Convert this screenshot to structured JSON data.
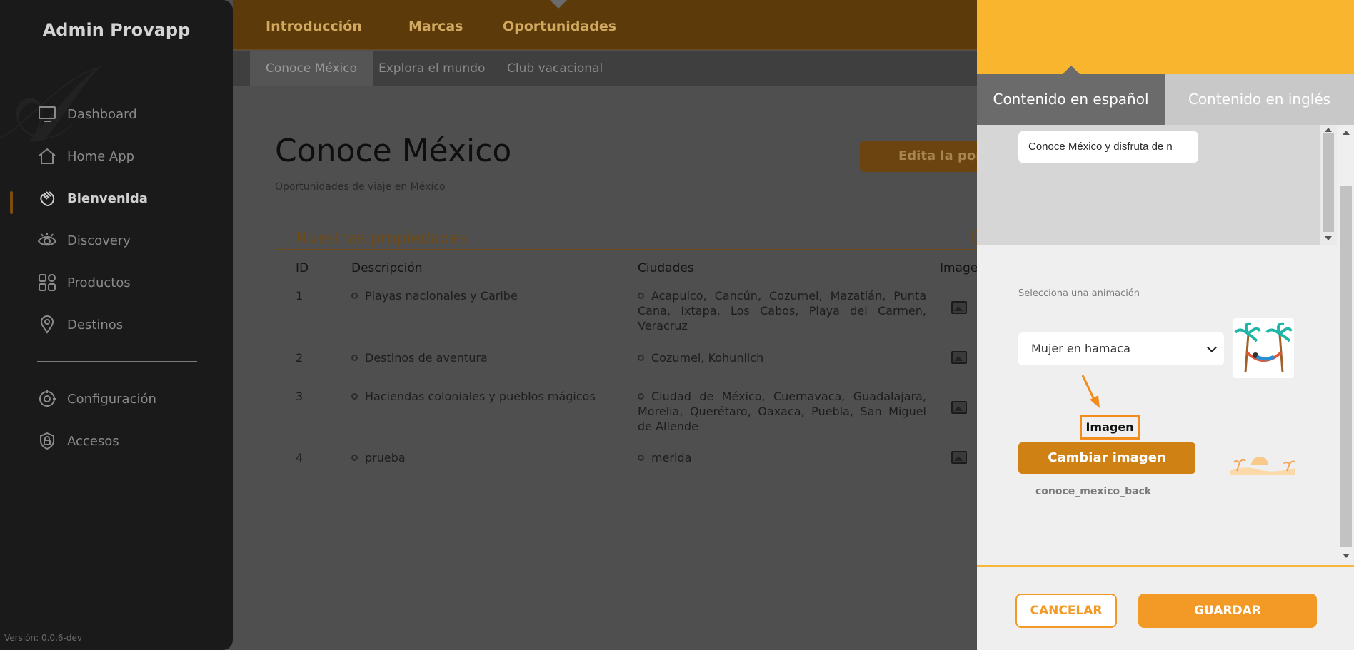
{
  "sidebar": {
    "brand": "Admin Provapp",
    "items": [
      {
        "label": "Dashboard",
        "icon": "monitor-icon"
      },
      {
        "label": "Home App",
        "icon": "home-icon"
      },
      {
        "label": "Bienvenida",
        "icon": "hand-wave-icon",
        "active": true
      },
      {
        "label": "Discovery",
        "icon": "eye-icon"
      },
      {
        "label": "Productos",
        "icon": "grid-icon"
      },
      {
        "label": "Destinos",
        "icon": "map-pin-icon"
      },
      {
        "label": "Configuración",
        "icon": "gear-icon"
      },
      {
        "label": "Accesos",
        "icon": "shield-lock-icon"
      }
    ],
    "version": "Versión: 0.0.6-dev"
  },
  "topbar": {
    "tabs": [
      "Introducción",
      "Marcas",
      "Oportunidades"
    ],
    "active_tab": "Oportunidades"
  },
  "subbar": {
    "tabs": [
      "Conoce México",
      "Explora el mundo",
      "Club vacacional"
    ],
    "active_tab": "Conoce México"
  },
  "main": {
    "title": "Conoce México",
    "subtitle": "Oportunidades de viaje en México",
    "edit_button": "Edita la port",
    "section_title": "Nuestras propiedades",
    "table": {
      "headers": [
        "ID",
        "Descripción",
        "Ciudades",
        "Imagen"
      ],
      "rows": [
        {
          "id": "1",
          "description": "Playas nacionales y Caribe",
          "cities": "Acapulco, Cancún, Cozumel, Mazatlán, Punta Cana, Ixtapa, Los Cabos, Playa del Carmen, Veracruz"
        },
        {
          "id": "2",
          "description": "Destinos de aventura",
          "cities": "Cozumel, Kohunlich"
        },
        {
          "id": "3",
          "description": "Haciendas coloniales y pueblos mágicos",
          "cities": "Ciudad de México, Cuernavaca, Guadalajara, Morelia, Querétaro, Oaxaca, Puebla, San Miguel de Allende"
        },
        {
          "id": "4",
          "description": "prueba",
          "cities": "merida"
        }
      ]
    }
  },
  "panel": {
    "tabs": {
      "spanish": "Contenido en español",
      "english": "Contenido en inglés"
    },
    "text_field_value": "Conoce México y disfruta de n",
    "animation_label": "Selecciona una animación",
    "animation_selected": "Mujer en hamaca",
    "image_label": "Imagen",
    "change_image_button": "Cambiar imagen",
    "file_name": "conoce_mexico_back",
    "cancel_button": "CANCELAR",
    "save_button": "GUARDAR"
  },
  "colors": {
    "accent": "#f39a26",
    "panel_header": "#f9b52d",
    "change_button": "#cf8113",
    "overlay_topbar": "#5c3a0a"
  }
}
